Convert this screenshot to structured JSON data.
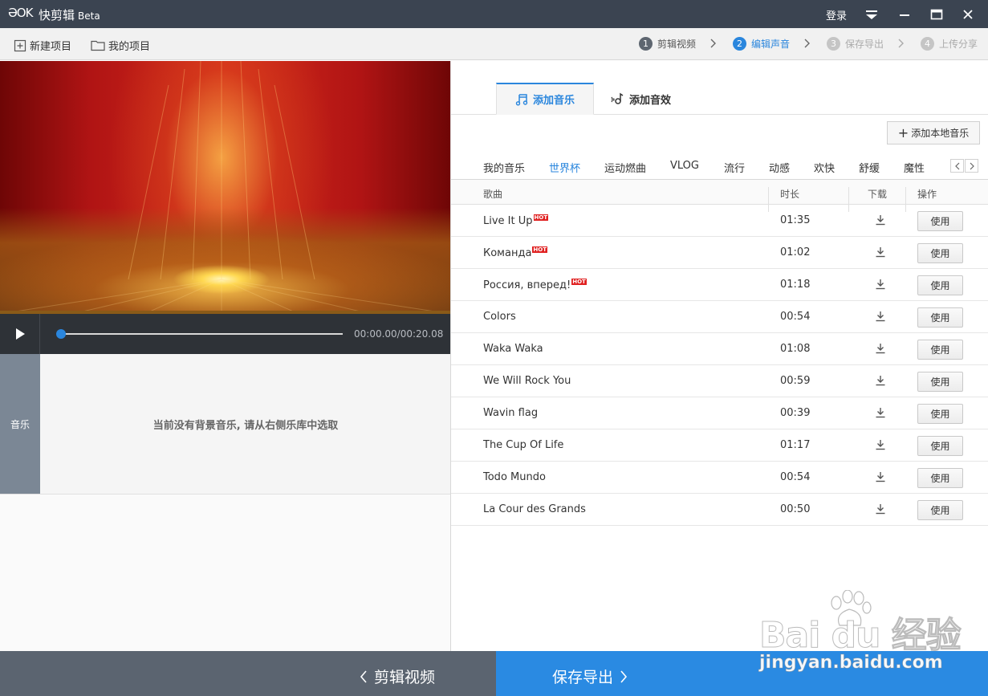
{
  "titlebar": {
    "logo": "ƏOK",
    "app_name": "快剪辑",
    "app_beta": "Beta",
    "login": "登录",
    "bg_color": "#3b4451"
  },
  "toolbar": {
    "new_project": "新建项目",
    "my_projects": "我的项目",
    "steps": [
      {
        "num": "1",
        "label": "剪辑视频",
        "state": "done"
      },
      {
        "num": "2",
        "label": "编辑声音",
        "state": "active"
      },
      {
        "num": "3",
        "label": "保存导出",
        "state": "disabled"
      },
      {
        "num": "4",
        "label": "上传分享",
        "state": "disabled"
      }
    ]
  },
  "player": {
    "time": "00:00.00/00:20.08",
    "progress": 0.0
  },
  "track": {
    "label": "音乐",
    "empty_text": "当前没有背景音乐, 请从右侧乐库中选取"
  },
  "music_panel": {
    "tabs": [
      "添加音乐",
      "添加音效"
    ],
    "add_local": "添加本地音乐",
    "categories": [
      "我的音乐",
      "世界杯",
      "运动燃曲",
      "VLOG",
      "流行",
      "动感",
      "欢快",
      "舒缓",
      "魔性"
    ],
    "active_category": "世界杯",
    "columns": [
      "歌曲",
      "时长",
      "下载",
      "操作"
    ],
    "hot_badge": "HOT",
    "use_label": "使用",
    "songs": [
      {
        "name": "Live It Up",
        "hot": true,
        "duration": "01:35"
      },
      {
        "name": "Команда",
        "hot": true,
        "duration": "01:02"
      },
      {
        "name": "Россия, вперед!",
        "hot": true,
        "duration": "01:18"
      },
      {
        "name": "Colors",
        "hot": false,
        "duration": "00:54"
      },
      {
        "name": "Waka Waka",
        "hot": false,
        "duration": "01:08"
      },
      {
        "name": "We Will Rock You",
        "hot": false,
        "duration": "00:59"
      },
      {
        "name": "Wavin flag",
        "hot": false,
        "duration": "00:39"
      },
      {
        "name": "The Cup Of Life",
        "hot": false,
        "duration": "01:17"
      },
      {
        "name": "Todo Mundo",
        "hot": false,
        "duration": "00:54"
      },
      {
        "name": "La Cour des Grands",
        "hot": false,
        "duration": "00:50"
      }
    ]
  },
  "bottom": {
    "prev": "剪辑视频",
    "next": "保存导出",
    "accent": "#2a8ae2"
  },
  "watermark": {
    "brand": "Bai du 经验",
    "url": "jingyan.baidu.com"
  }
}
